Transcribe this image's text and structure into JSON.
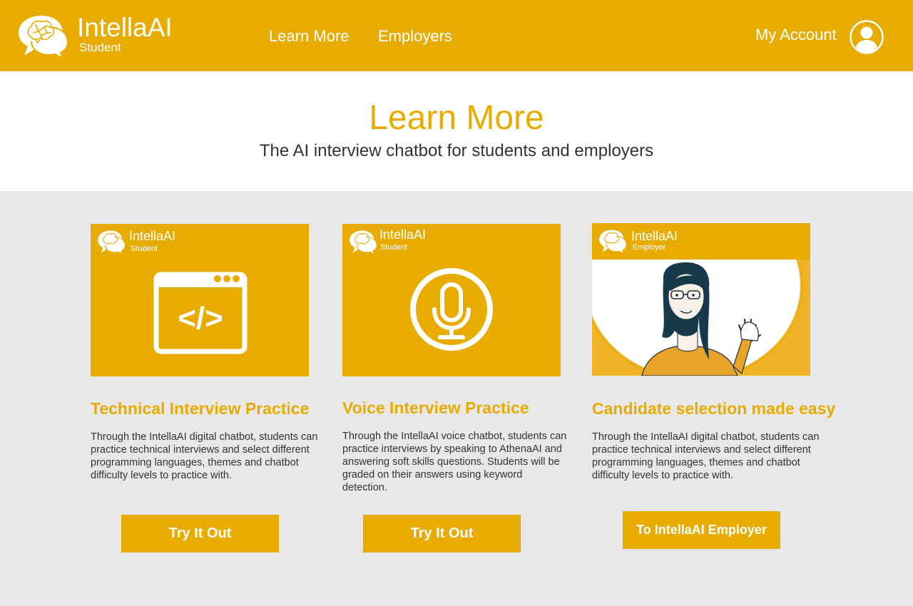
{
  "brand": {
    "name": "IntellaAI",
    "sub": "Student"
  },
  "nav": {
    "learn_more": "Learn More",
    "employers": "Employers",
    "account": "My Account"
  },
  "hero": {
    "title": "Learn More",
    "subtitle": "The AI interview chatbot for students and employers"
  },
  "cards": [
    {
      "logo_name": "IntellaAI",
      "logo_sub": "Student",
      "icon": "code-window-icon",
      "title": "Technical Interview Practice",
      "description": "Through the IntellaAI digital chatbot, students can practice technical interviews and select different programming languages, themes and chatbot difficulty levels to practice with.",
      "button": "Try It Out"
    },
    {
      "logo_name": "IntellaAI",
      "logo_sub": "Student",
      "icon": "microphone-icon",
      "title": "Voice Interview Practice",
      "description": "Through the IntellaAI voice chatbot, students can practice interviews by speaking to AthenaAI and answering soft skills questions. Students will be graded on their answers using keyword detection.",
      "button": "Try It Out"
    },
    {
      "logo_name": "IntellaAI",
      "logo_sub": "Employer",
      "icon": "waving-woman-illustration",
      "title": "Candidate selection made easy",
      "description": "Through the IntellaAI digital chatbot, students can practice technical interviews and select different programming languages, themes and chatbot difficulty levels to practice with.",
      "button": "To IntellaAI Employer"
    }
  ],
  "colors": {
    "accent": "#e8ac00",
    "page_bg": "#e8e8e8",
    "text": "#333333"
  }
}
